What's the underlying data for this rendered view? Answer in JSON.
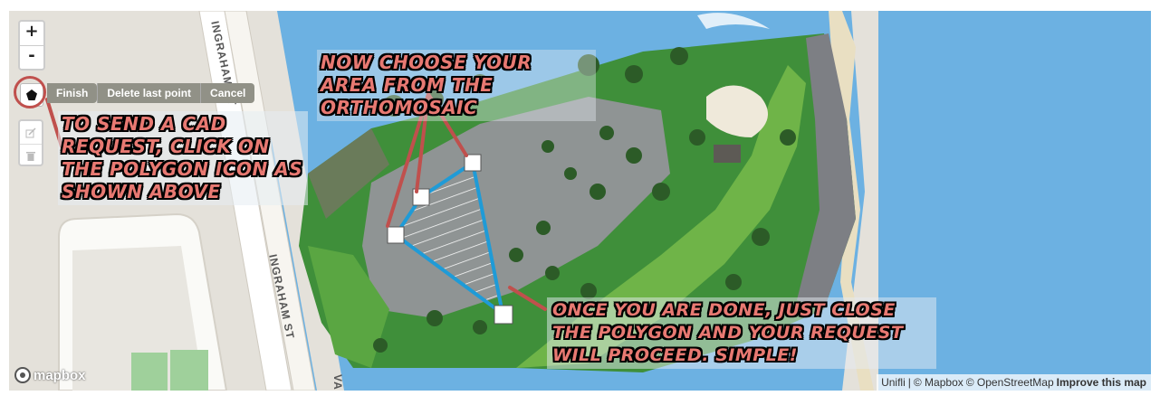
{
  "map": {
    "zoom_in_label": "+",
    "zoom_out_label": "-",
    "street_label_top": "INGRAHAM ST",
    "street_label_bottom": "INGRAHAM ST",
    "street_label_fragment": "VAC",
    "logo_text": "mapbox"
  },
  "draw_toolbar": {
    "finish_label": "Finish",
    "delete_last_point_label": "Delete last point",
    "cancel_label": "Cancel"
  },
  "annotations": {
    "polygon_hint": "To send a CAD request, click on the polygon icon as shown above",
    "choose_area": "Now choose your area from the orthomosaic",
    "close_polygon": "Once you are done, just close the polygon and your request will proceed. Simple!"
  },
  "attribution": {
    "unifli": "Unifli",
    "sep1": "|",
    "mapbox": "© Mapbox",
    "osm": "© OpenStreetMap",
    "improve": "Improve this map"
  },
  "colors": {
    "water": "#6cb1e2",
    "polygon_stroke": "#1f9bd7",
    "annotation_text": "#e87972",
    "highlight": "#c0504d"
  }
}
